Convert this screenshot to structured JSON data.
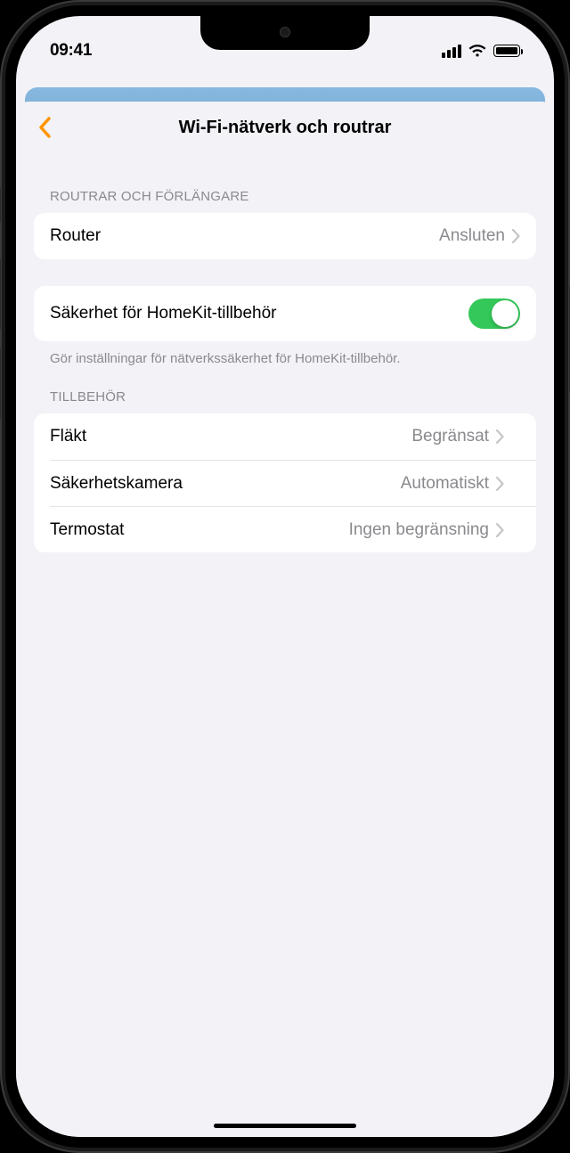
{
  "status": {
    "time": "09:41"
  },
  "nav": {
    "title": "Wi-Fi-nätverk och routrar"
  },
  "section_routers": {
    "header": "ROUTRAR OCH FÖRLÄNGARE",
    "router_label": "Router",
    "router_value": "Ansluten"
  },
  "security": {
    "label": "Säkerhet för HomeKit-tillbehör",
    "footer": "Gör inställningar för nätverkssäkerhet för HomeKit-tillbehör.",
    "enabled": true
  },
  "section_accessories": {
    "header": "TILLBEHÖR",
    "items": [
      {
        "label": "Fläkt",
        "value": "Begränsat"
      },
      {
        "label": "Säkerhetskamera",
        "value": "Automatiskt"
      },
      {
        "label": "Termostat",
        "value": "Ingen begränsning"
      }
    ]
  }
}
